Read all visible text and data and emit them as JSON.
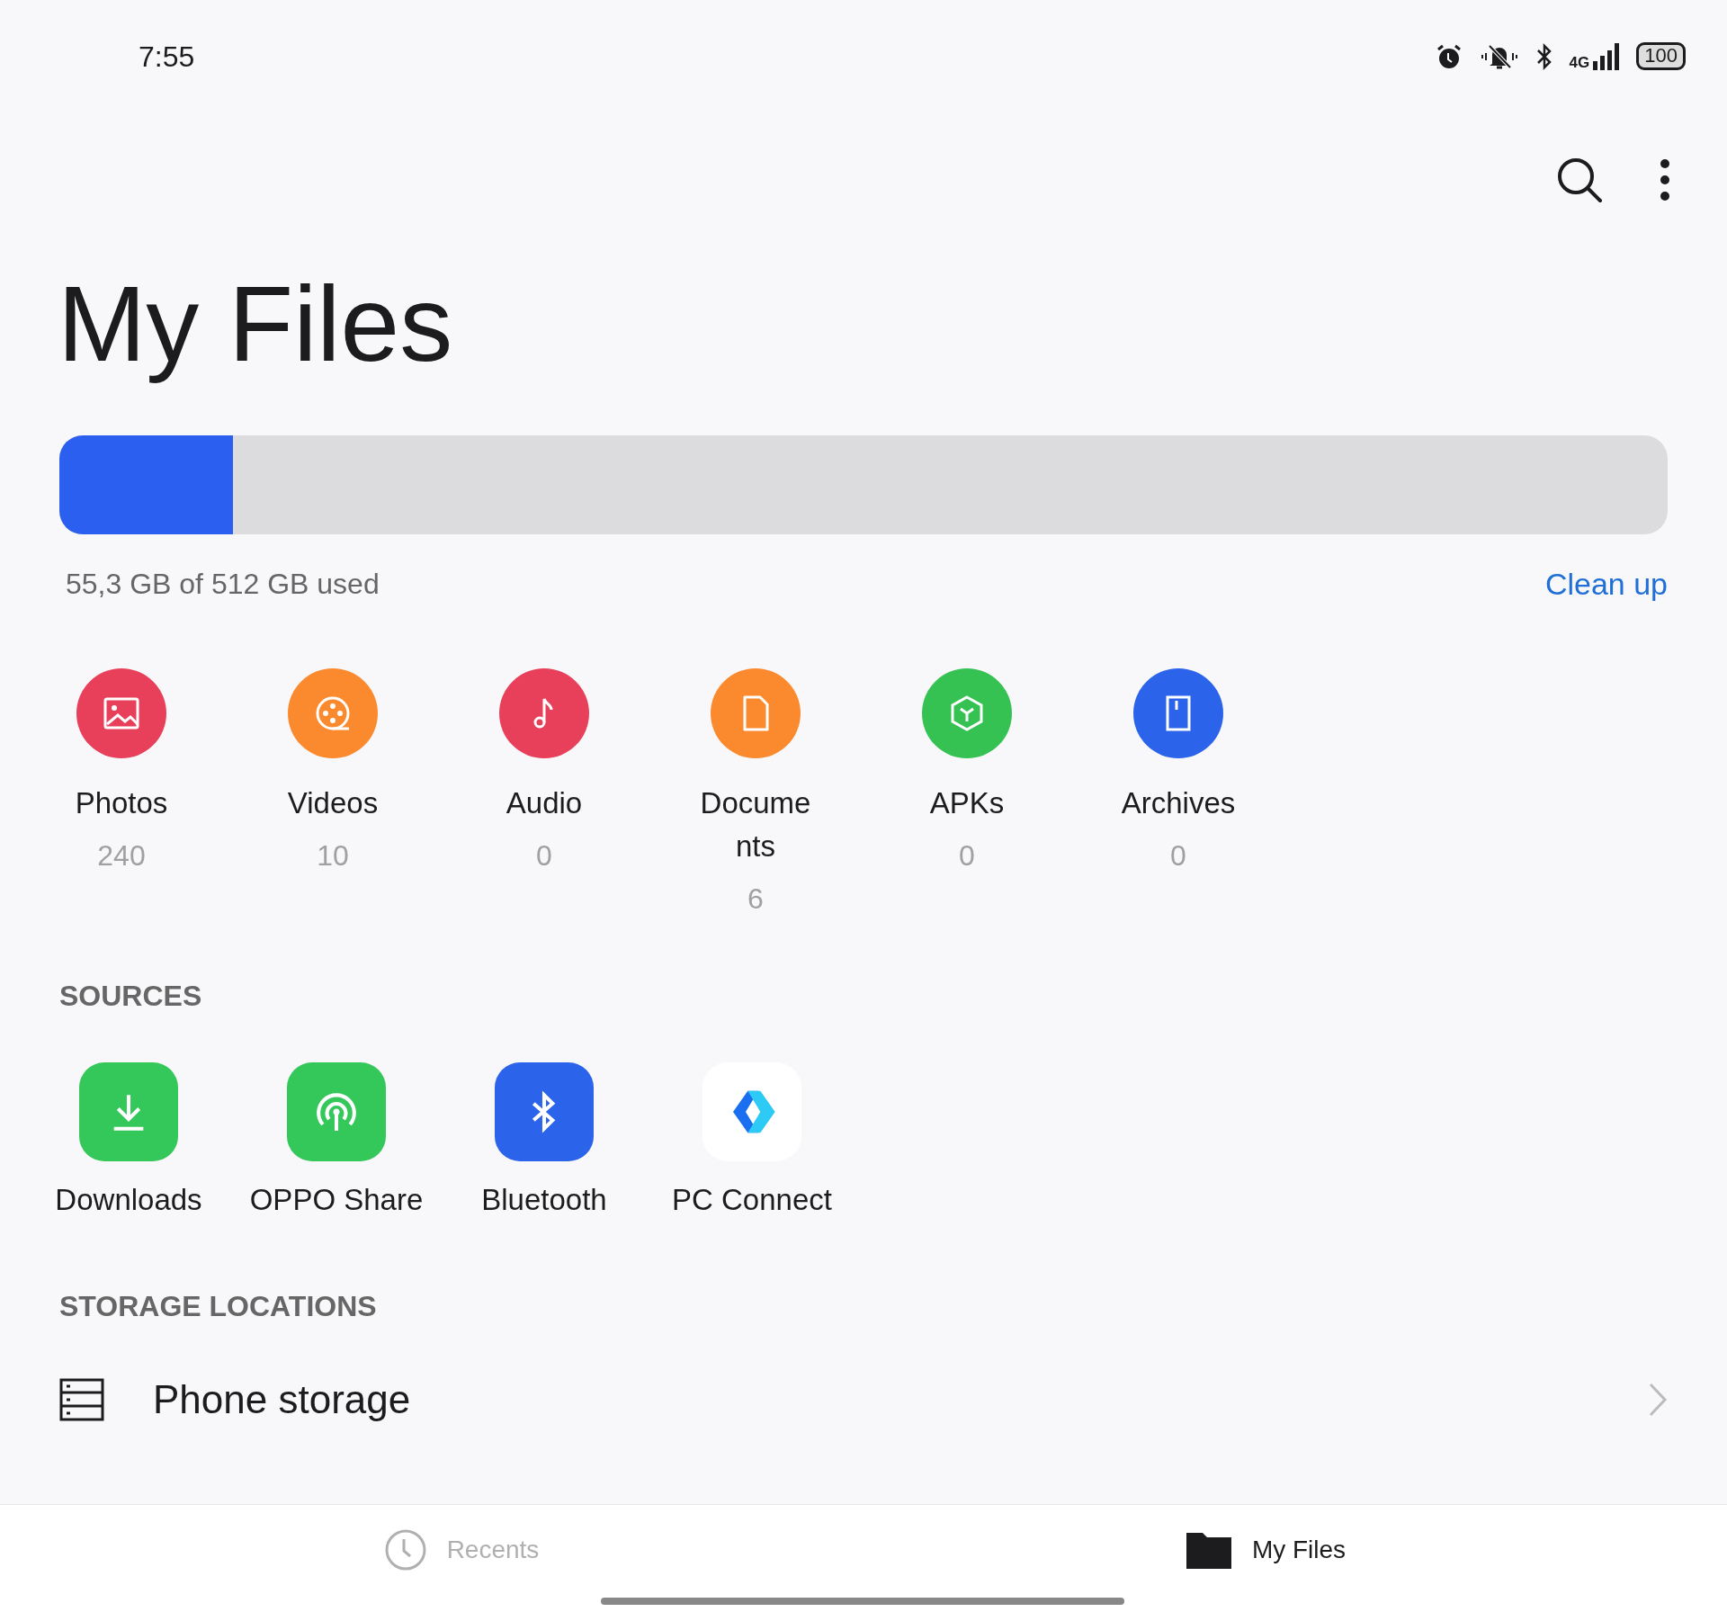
{
  "status_bar": {
    "time": "7:55",
    "network": "4G",
    "battery": "100"
  },
  "title": "My Files",
  "storage": {
    "level": 0.108,
    "usage": "55,3 GB of 512 GB used",
    "action": "Clean up"
  },
  "categories": [
    {
      "kind": "photos",
      "label": "Photos",
      "count": "240",
      "color": "#e8405a"
    },
    {
      "kind": "videos",
      "label": "Videos",
      "count": "10",
      "color": "#fb8a2e"
    },
    {
      "kind": "audio",
      "label": "Audio",
      "count": "0",
      "color": "#e8405a"
    },
    {
      "kind": "documents",
      "label": "Documents",
      "count": "6",
      "color": "#fb8a2e"
    },
    {
      "kind": "apks",
      "label": "APKs",
      "count": "0",
      "color": "#35c253"
    },
    {
      "kind": "archives",
      "label": "Archives",
      "count": "0",
      "color": "#2b63eb"
    }
  ],
  "sources_heading": "SOURCES",
  "sources": [
    {
      "kind": "downloads",
      "label": "Downloads"
    },
    {
      "kind": "share",
      "label": "OPPO Share"
    },
    {
      "kind": "bluetooth",
      "label": "Bluetooth"
    },
    {
      "kind": "pc",
      "label": "PC Connect"
    }
  ],
  "storage_heading": "STORAGE LOCATIONS",
  "locations": [
    {
      "label": "Phone storage"
    }
  ],
  "bottom_nav": [
    {
      "kind": "recents",
      "label": "Recents",
      "selected": false
    },
    {
      "kind": "files",
      "label": "My Files",
      "selected": true
    }
  ]
}
